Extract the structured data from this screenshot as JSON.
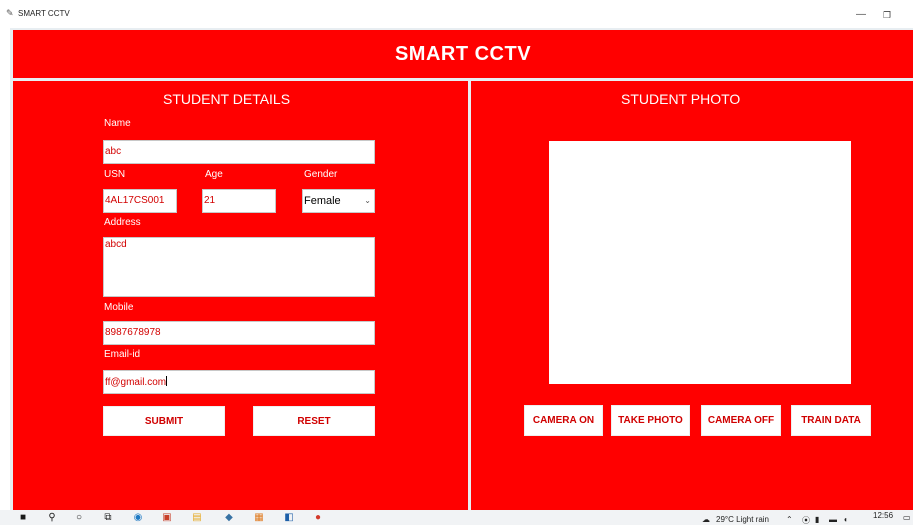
{
  "window": {
    "title": "SMART CCTV",
    "controls": {
      "minimize": "—",
      "restore": "❐"
    }
  },
  "header": {
    "title": "SMART CCTV"
  },
  "student_details": {
    "title": "STUDENT DETAILS",
    "name": {
      "label": "Name",
      "value": "abc"
    },
    "usn": {
      "label": "USN",
      "value": "4AL17CS001"
    },
    "age": {
      "label": "Age",
      "value": "21"
    },
    "gender": {
      "label": "Gender",
      "value": "Female"
    },
    "address": {
      "label": "Address",
      "value": "abcd"
    },
    "mobile": {
      "label": "Mobile",
      "value": "8987678978"
    },
    "email": {
      "label": "Email-id",
      "value": "ff@gmail.com"
    },
    "buttons": {
      "submit": "SUBMIT",
      "reset": "RESET"
    }
  },
  "student_photo": {
    "title": "STUDENT PHOTO",
    "buttons": {
      "camera_on": "CAMERA ON",
      "take_photo": "TAKE PHOTO",
      "camera_off": "CAMERA OFF",
      "train_data": "TRAIN DATA"
    }
  },
  "taskbar": {
    "icons": [
      "windows-start-icon",
      "search-icon",
      "cortana-icon",
      "task-view-icon",
      "edge-icon",
      "powerpoint-icon",
      "file-explorer-icon",
      "python-icon",
      "app-icon",
      "vscode-icon",
      "chrome-icon"
    ],
    "weather": "29°C  Light rain",
    "time": "12:56",
    "colors": {
      "accent": "#ff0000"
    }
  }
}
